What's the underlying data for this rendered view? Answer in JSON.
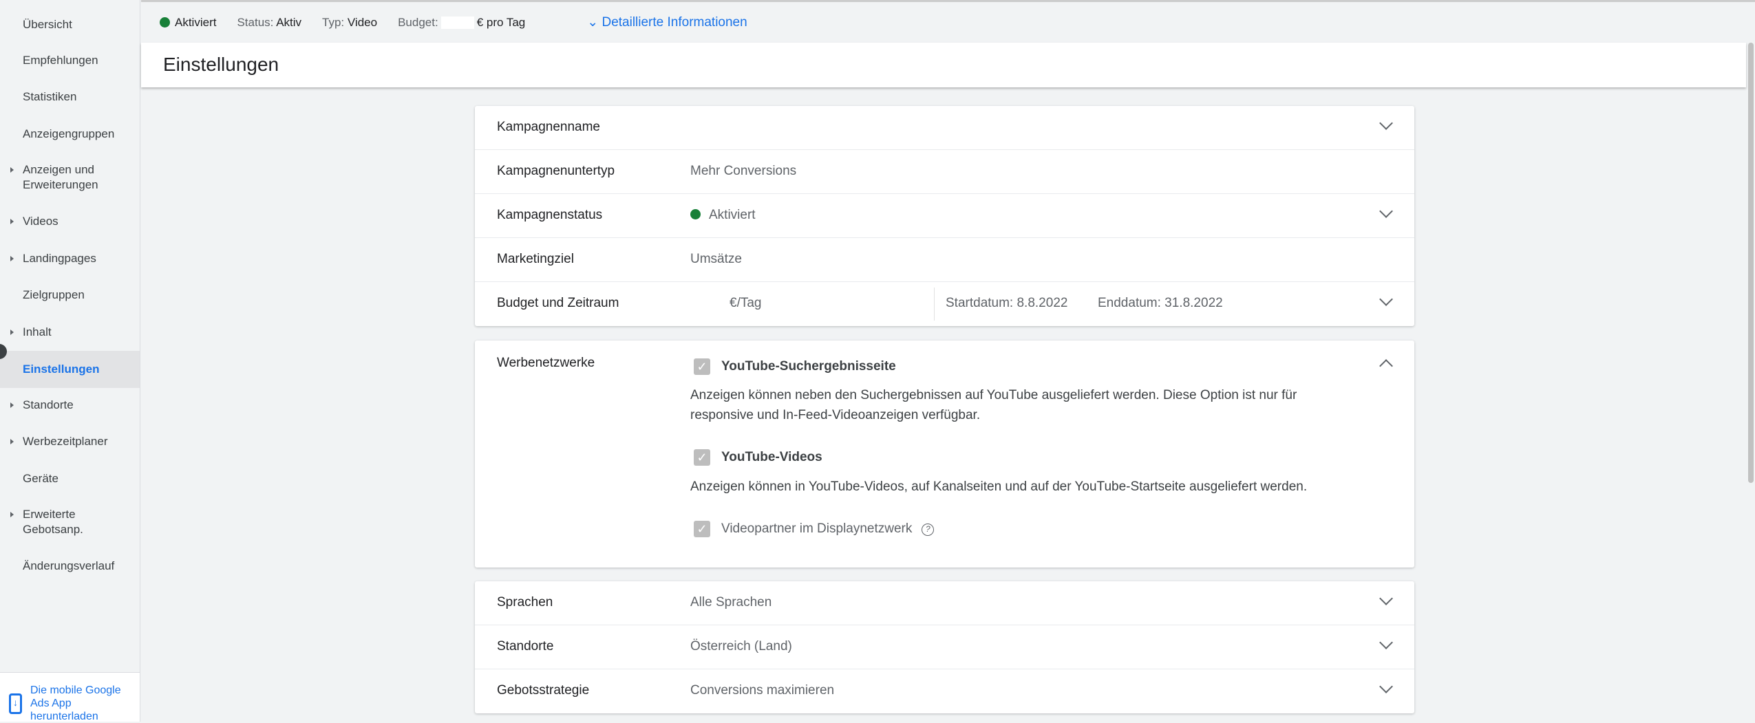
{
  "sidebar": {
    "items": [
      {
        "label": "Übersicht",
        "expandable": false
      },
      {
        "label": "Empfehlungen",
        "expandable": false
      },
      {
        "label": "Statistiken",
        "expandable": false
      },
      {
        "label": "Anzeigengruppen",
        "expandable": false
      },
      {
        "label": "Anzeigen und Erweiterungen",
        "expandable": true
      },
      {
        "label": "Videos",
        "expandable": true
      },
      {
        "label": "Landingpages",
        "expandable": true
      },
      {
        "label": "Zielgruppen",
        "expandable": false
      },
      {
        "label": "Inhalt",
        "expandable": true
      },
      {
        "label": "Einstellungen",
        "expandable": false,
        "active": true
      },
      {
        "label": "Standorte",
        "expandable": true
      },
      {
        "label": "Werbezeitplaner",
        "expandable": true
      },
      {
        "label": "Geräte",
        "expandable": false
      },
      {
        "label": "Erweiterte Gebotsanp.",
        "expandable": true
      },
      {
        "label": "Änderungsverlauf",
        "expandable": false
      }
    ],
    "mobile_app": "Die mobile Google Ads App herunterladen"
  },
  "topbar": {
    "status": "Aktiviert",
    "status_label": "Status:",
    "status_value": "Aktiv",
    "type_label": "Typ:",
    "type_value": "Video",
    "budget_label": "Budget:",
    "budget_suffix": "€ pro Tag",
    "details": "Detaillierte Informationen"
  },
  "page_title": "Einstellungen",
  "settings": {
    "campaign_name": {
      "label": "Kampagnenname",
      "value": ""
    },
    "subtype": {
      "label": "Kampagnenuntertyp",
      "value": "Mehr Conversions"
    },
    "status": {
      "label": "Kampagnenstatus",
      "value": "Aktiviert"
    },
    "goal": {
      "label": "Marketingziel",
      "value": "Umsätze"
    },
    "budget": {
      "label": "Budget und Zeitraum",
      "value": "€/Tag",
      "start": "Startdatum: 8.8.2022",
      "end": "Enddatum: 31.8.2022"
    },
    "networks": {
      "label": "Werbenetzwerke",
      "options": [
        {
          "label": "YouTube-Suchergebnisseite",
          "checked": true,
          "description": "Anzeigen können neben den Suchergebnissen auf YouTube ausgeliefert werden. Diese Option ist nur für responsive und In-Feed-Videoanzeigen verfügbar."
        },
        {
          "label": "YouTube-Videos",
          "checked": true,
          "description": "Anzeigen können in YouTube-Videos, auf Kanalseiten und auf der YouTube-Startseite ausgeliefert werden."
        },
        {
          "label": "Videopartner im Displaynetzwerk",
          "checked": true
        }
      ]
    },
    "languages": {
      "label": "Sprachen",
      "value": "Alle Sprachen"
    },
    "locations": {
      "label": "Standorte",
      "value": "Österreich (Land)"
    },
    "bidding": {
      "label": "Gebotsstrategie",
      "value": "Conversions maximieren"
    }
  },
  "colors": {
    "accent": "#1a73e8",
    "active_green": "#188038"
  }
}
